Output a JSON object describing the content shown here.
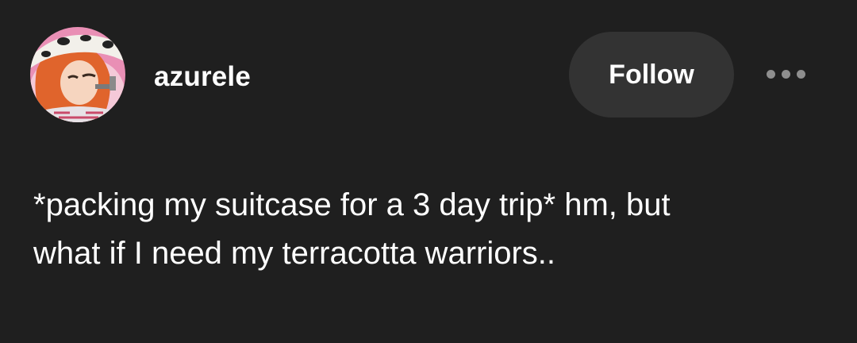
{
  "post": {
    "author": {
      "username": "azurele",
      "avatar_icon": "anime-character-avatar"
    },
    "follow_label": "Follow",
    "more_icon": "more-options-icon",
    "body_lines": [
      "*packing my suitcase for a 3 day trip* hm, but",
      "what if I need my terracotta warriors.."
    ]
  },
  "colors": {
    "background": "#1f1f1f",
    "follow_button_bg": "#333333",
    "text": "#ffffff",
    "dots": "#8e8e8e"
  }
}
